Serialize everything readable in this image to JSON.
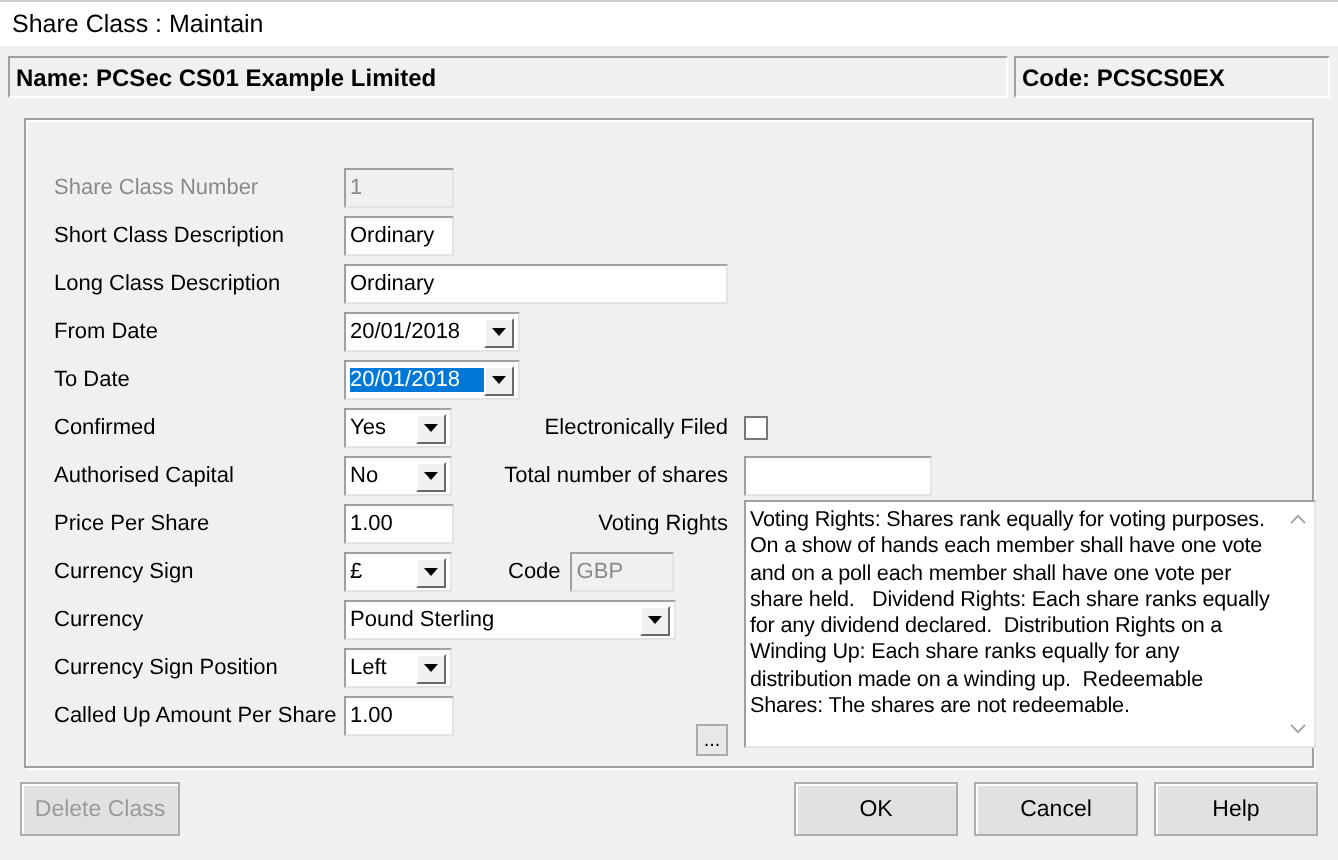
{
  "window": {
    "title": "Share Class : Maintain"
  },
  "header": {
    "name": "Name: PCSec CS01 Example Limited",
    "code": "Code: PCSCS0EX"
  },
  "rows": [
    {
      "label": "Share Class Number",
      "control": {
        "kind": "text",
        "value": "1",
        "disabled": true,
        "selected": false
      }
    },
    {
      "label": "Short Class Description",
      "control": {
        "kind": "text",
        "value": "Ordinary",
        "disabled": false,
        "selected": false
      }
    },
    {
      "label": "Long Class Description",
      "control": {
        "kind": "text_wide",
        "value": "Ordinary",
        "disabled": false,
        "selected": false
      }
    },
    {
      "label": "From Date",
      "control": {
        "kind": "date",
        "value": "20/01/2018",
        "disabled": false,
        "selected": false
      }
    },
    {
      "label": "To Date",
      "control": {
        "kind": "date",
        "value": "20/01/2018",
        "disabled": false,
        "selected": true
      }
    },
    {
      "label": "Confirmed",
      "control": {
        "kind": "select",
        "value": "Yes",
        "disabled": false,
        "selected": false
      },
      "aside": {
        "label": "Electronically Filed",
        "kind": "checkbox",
        "checked": false
      }
    },
    {
      "label": "Authorised Capital",
      "control": {
        "kind": "select",
        "value": "No",
        "disabled": false,
        "selected": false
      },
      "aside": {
        "label": "Total number of shares",
        "kind": "text"
      }
    },
    {
      "label": "Price Per Share",
      "control": {
        "kind": "text",
        "value": "1.00",
        "disabled": false,
        "selected": false
      },
      "aside": {
        "label": "Voting Rights",
        "kind": "textarea",
        "value": "Voting Rights: Shares rank equally for voting purposes.  On a show of hands each member shall have one vote and on a poll each member shall have one vote per share held.   Dividend Rights: Each share ranks equally for any dividend declared.  Distribution Rights on a Winding Up: Each share ranks equally for any distribution made on a winding up.  Redeemable Shares: The shares are not redeemable."
      }
    },
    {
      "label": "Currency Sign",
      "control": {
        "kind": "select",
        "value": "£",
        "disabled": false,
        "selected": false
      },
      "code": {
        "label": "Code",
        "value": "GBP",
        "disabled": true
      }
    },
    {
      "label": "Currency",
      "control": {
        "kind": "select_wide",
        "value": "Pound Sterling",
        "disabled": false,
        "selected": false
      }
    },
    {
      "label": "Currency Sign Position",
      "control": {
        "kind": "select",
        "value": "Left",
        "disabled": false,
        "selected": false
      }
    },
    {
      "label": "Called Up Amount Per Share",
      "control": {
        "kind": "text",
        "value": "1.00",
        "disabled": false,
        "selected": false
      },
      "more_button": "..."
    }
  ],
  "buttons": [
    {
      "label": "Delete Class",
      "disabled": true
    },
    {
      "label": "OK",
      "disabled": false
    },
    {
      "label": "Cancel",
      "disabled": false
    },
    {
      "label": "Help",
      "disabled": false
    }
  ]
}
